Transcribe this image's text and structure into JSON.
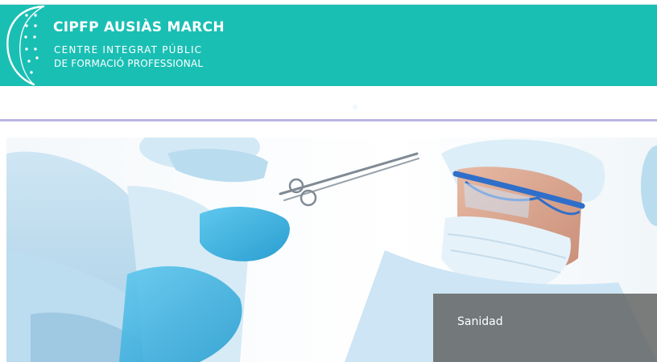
{
  "header": {
    "logo": {
      "title": "CIPFP AUSIÀS MARCH",
      "subtitle_line1": "CENTRE INTEGRAT PÚBLIC",
      "subtitle_line2": "DE FORMACIÓ PROFESSIONAL"
    }
  },
  "slider": {
    "current_slide": {
      "caption": "Sanidad",
      "image_subject": "surgical team operating"
    }
  },
  "colors": {
    "header_background": "#1abfb4",
    "nav_border": "#b9b6e4",
    "caption_background": "#5f5f5f"
  }
}
